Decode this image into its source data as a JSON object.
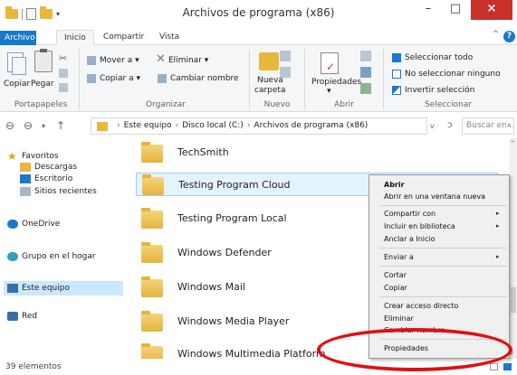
{
  "window": {
    "title": "Archivos de programa (x86)",
    "minimize_glyph": "–",
    "maximize_glyph": "□",
    "close_glyph": "×"
  },
  "ribbon_tabs": {
    "archivo": "Archivo",
    "inicio": "Inicio",
    "compartir": "Compartir",
    "vista": "Vista",
    "collapse": "^",
    "help": "?"
  },
  "ribbon": {
    "portapapeles": {
      "label": "Portapapeles",
      "copiar": "Copiar",
      "pegar": "Pegar"
    },
    "organizar": {
      "label": "Organizar",
      "mover_a": "Mover a ▾",
      "copiar_a": "Copiar a ▾",
      "eliminar": "Eliminar ▾",
      "cambiar_nombre": "Cambiar nombre"
    },
    "nuevo": {
      "label": "Nuevo",
      "nueva_carpeta_1": "Nueva",
      "nueva_carpeta_2": "carpeta"
    },
    "abrir": {
      "label": "Abrir",
      "propiedades": "Propiedades",
      "propiedades_arrow": "▾"
    },
    "seleccionar": {
      "label": "Seleccionar",
      "seleccionar_todo": "Seleccionar todo",
      "no_seleccionar": "No seleccionar ninguno",
      "invertir": "Invertir selección"
    }
  },
  "address": {
    "back": "⊖",
    "forward": "⊖",
    "recent": "▾",
    "up": "↑",
    "crumbs": [
      "Este equipo",
      "Disco local (C:)",
      "Archivos de programa (x86)"
    ],
    "dropdown": "v",
    "refresh": "ↄ",
    "search_placeholder": "Buscar en ...",
    "search_glyph": "⌕"
  },
  "nav": {
    "favoritos": "Favoritos",
    "descargas": "Descargas",
    "escritorio": "Escritorio",
    "sitios_recientes": "Sitios recientes",
    "onedrive": "OneDrive",
    "grupo_hogar": "Grupo en el hogar",
    "este_equipo": "Este equipo",
    "red": "Red"
  },
  "files": [
    "TechSmith",
    "Testing Program Cloud",
    "Testing Program Local",
    "Windows Defender",
    "Windows Mail",
    "Windows Media Player",
    "Windows Multimedia Platform"
  ],
  "status": {
    "count": "39 elementos"
  },
  "context_menu": {
    "abrir": "Abrir",
    "abrir_nueva_ventana": "Abrir en una ventana nueva",
    "compartir_con": "Compartir con",
    "incluir_biblioteca": "Incluir en biblioteca",
    "anclar_inicio": "Anclar a Inicio",
    "enviar_a": "Enviar a",
    "cortar": "Cortar",
    "copiar": "Copiar",
    "crear_acceso": "Crear acceso directo",
    "eliminar": "Eliminar",
    "cambiar_nombre": "Cambiar nombre",
    "propiedades": "Propiedades",
    "submenu_arrow": "▸"
  },
  "scrollbar": {
    "up": "^",
    "down": "v"
  },
  "colors": {
    "accent": "#1979ca",
    "close_red": "#c7312a",
    "annotation_red": "#e01010",
    "folder_yellow": "#e8b73b"
  }
}
